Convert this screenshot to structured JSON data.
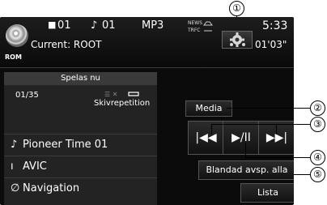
{
  "header": {
    "folder_num": "01",
    "track_num": "01",
    "format": "MP3",
    "news_label": "NEWS",
    "trfc_label": "TRFC",
    "clock": "5:33",
    "current_label": "Current: ROOT",
    "elapsed": "01'03\"",
    "source_label": "ROM"
  },
  "left_panel": {
    "title": "Spelas nu",
    "track_position": "01/35",
    "repeat_label": "Skivrepetition",
    "song": "Pioneer Time 01",
    "artist": "AVIC",
    "album": "Navigation"
  },
  "controls": {
    "media_label": "Media",
    "prev_icon": "skip-back-icon",
    "play_pause_icon": "play-pause-icon",
    "next_icon": "skip-forward-icon",
    "shuffle_label": "Blandad avsp. alla",
    "list_label": "Lista"
  },
  "callouts": [
    "①",
    "②",
    "③",
    "④",
    "⑤"
  ]
}
